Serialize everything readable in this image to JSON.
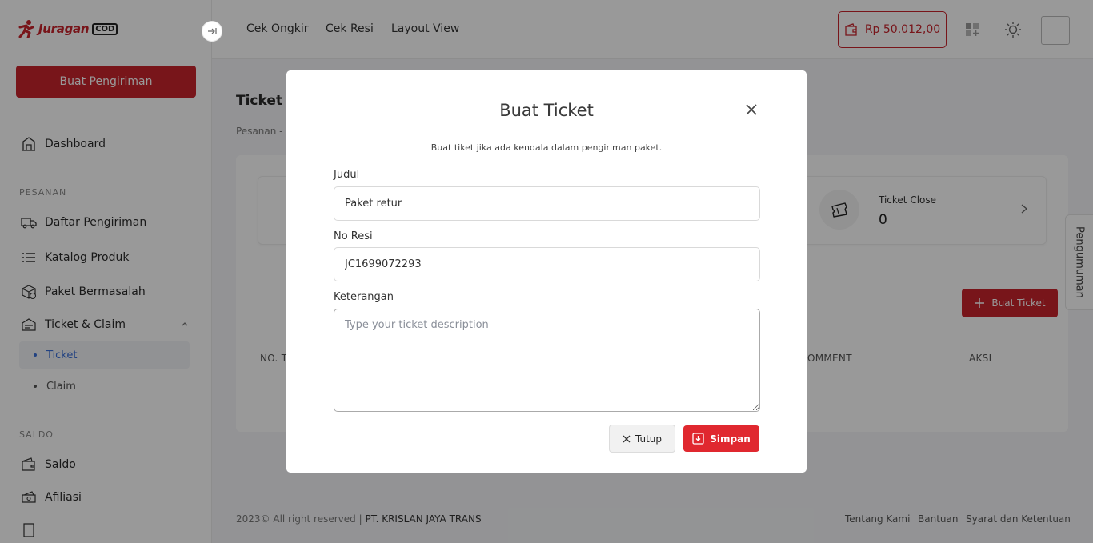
{
  "brand": {
    "name": "Juragan",
    "suffix": "COD"
  },
  "sidebar": {
    "create_button": "Buat Pengiriman",
    "dashboard": "Dashboard",
    "section_pesanan": "PESANAN",
    "items": [
      {
        "label": "Daftar Pengiriman",
        "icon": "truck-icon"
      },
      {
        "label": "Katalog Produk",
        "icon": "list-icon"
      },
      {
        "label": "Paket Bermasalah",
        "icon": "box-alert-icon"
      },
      {
        "label": "Ticket & Claim",
        "icon": "ticket-icon"
      }
    ],
    "sub_items": [
      {
        "label": "Ticket",
        "active": true
      },
      {
        "label": "Claim",
        "active": false
      }
    ],
    "section_saldo": "SALDO",
    "saldo_items": [
      {
        "label": "Saldo",
        "icon": "wallet-icon"
      },
      {
        "label": "Afiliasi",
        "icon": "money-icon"
      }
    ]
  },
  "topbar": {
    "links": [
      "Cek Ongkir",
      "Cek Resi",
      "Layout View"
    ],
    "balance": "Rp 50.012,00"
  },
  "page": {
    "title": "Ticket",
    "breadcrumb": "Pesanan -",
    "stat_close_label": "Ticket Close",
    "stat_close_value": "0",
    "buat_ticket_button": "Buat Ticket",
    "table_headers": [
      "NO. T",
      "OMMENT",
      "AKSI"
    ],
    "side_tab": "Pengumuman"
  },
  "footer": {
    "copyright": "2023© All right reserved | ",
    "company": "PT. KRISLAN JAYA TRANS",
    "links": [
      "Tentang Kami",
      "Bantuan",
      "Syarat dan Ketentuan"
    ]
  },
  "modal": {
    "title": "Buat Ticket",
    "subtitle": "Buat tiket jika ada kendala dalam pengiriman paket.",
    "fields": {
      "judul_label": "Judul",
      "judul_value": "Paket retur",
      "resi_label": "No Resi",
      "resi_value": "JC1699072293",
      "keterangan_label": "Keterangan",
      "keterangan_placeholder": "Type your ticket description"
    },
    "close_button": "Tutup",
    "save_button": "Simpan"
  },
  "colors": {
    "brand_red": "#c8232c",
    "save_red": "#e0282f",
    "active_blue": "#3a6fd8"
  }
}
